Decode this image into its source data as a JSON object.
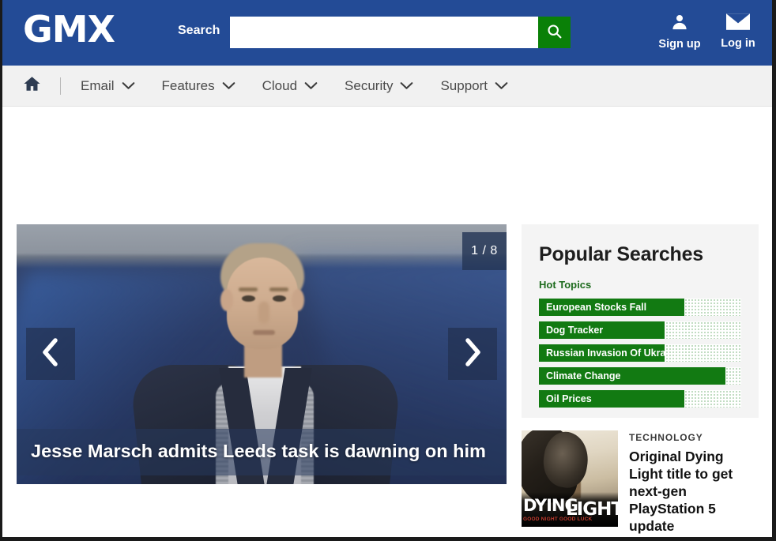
{
  "header": {
    "logo": "GMX",
    "search_label": "Search",
    "search_value": "",
    "search_placeholder": "",
    "search_button_icon": "search-icon",
    "signup_label": "Sign up",
    "signup_icon": "user-icon",
    "login_label": "Log in",
    "login_icon": "envelope-icon",
    "background_color": "#234b96",
    "search_button_color": "#0a8007"
  },
  "nav": {
    "home_icon": "home-icon",
    "items": [
      {
        "label": "Email",
        "icon": "chevron-down-icon"
      },
      {
        "label": "Features",
        "icon": "chevron-down-icon"
      },
      {
        "label": "Cloud",
        "icon": "chevron-down-icon"
      },
      {
        "label": "Security",
        "icon": "chevron-down-icon"
      },
      {
        "label": "Support",
        "icon": "chevron-down-icon"
      }
    ]
  },
  "hero": {
    "counter": "1 / 8",
    "prev_icon": "chevron-left-icon",
    "next_icon": "chevron-right-icon",
    "caption": "Jesse Marsch admits Leeds task is dawning on him"
  },
  "sidebar": {
    "popular": {
      "title": "Popular Searches",
      "subtitle": "Hot Topics",
      "accent_color": "#127a12",
      "topics": [
        {
          "label": "European Stocks Fall",
          "percent": 72
        },
        {
          "label": "Dog Tracker",
          "percent": 62
        },
        {
          "label": "Russian Invasion Of Ukra...",
          "percent": 62
        },
        {
          "label": "Climate Change",
          "percent": 92
        },
        {
          "label": "Oil Prices",
          "percent": 72
        }
      ]
    },
    "article": {
      "category": "TECHNOLOGY",
      "headline": "Original Dying Light title to get next-gen PlayStation 5 update",
      "thumb_title_1": "DYING",
      "thumb_title_2": "LIGHT",
      "thumb_tagline": "GOOD NIGHT GOOD LUCK"
    }
  }
}
